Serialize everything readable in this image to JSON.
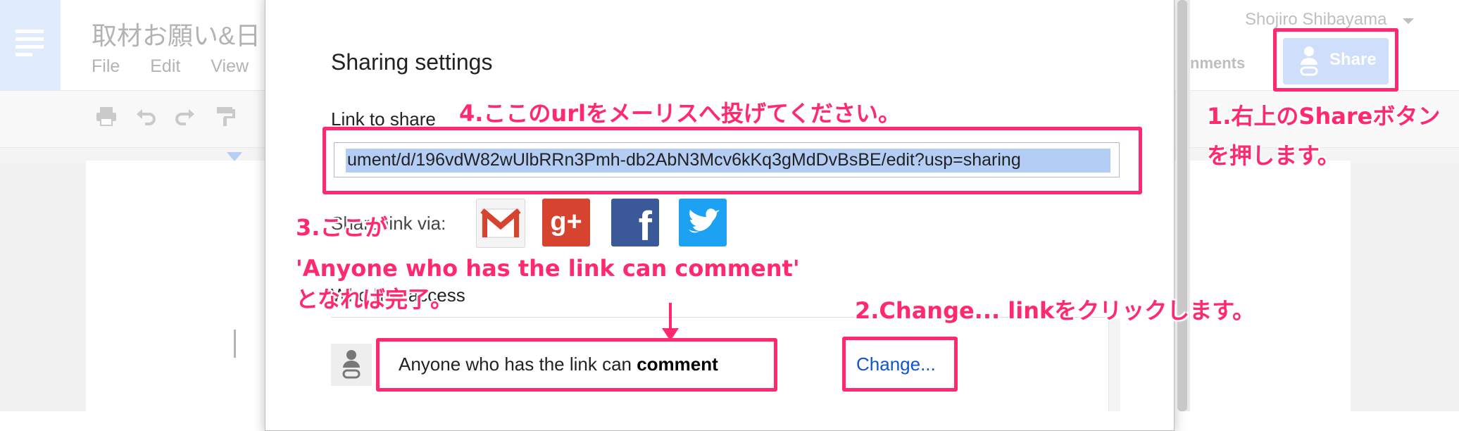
{
  "docs": {
    "title": "取材お願い&日",
    "menu": [
      "File",
      "Edit",
      "View"
    ],
    "user_name": "Shojiro Shibayama",
    "comments_label": "nments",
    "share_label": "Share"
  },
  "dialog": {
    "title": "Sharing settings",
    "link_label": "Link to share",
    "url": "ument/d/196vdW82wUlbRRn3Pmh-db2AbN3Mcv6kKq3gMdDvBsBE/edit?usp=sharing",
    "share_via_label": "Share link via:",
    "social": [
      {
        "name": "gmail",
        "glyph": "M",
        "color": "#d6432f"
      },
      {
        "name": "google-plus",
        "glyph": "g+",
        "color": "#d6432f"
      },
      {
        "name": "facebook",
        "glyph": "f",
        "color": "#3b5998"
      },
      {
        "name": "twitter",
        "glyph": "🐦",
        "color": "#1da1f2"
      }
    ],
    "who_label": "Who has access",
    "access_prefix": "Anyone who has the link can ",
    "access_level": "comment",
    "change_label": "Change..."
  },
  "annotations": {
    "step1_line1": "1.右上のShareボタン",
    "step1_line2": "を押します。",
    "step2": "2.Change... linkをクリックします。",
    "step3_line1": "3.ここが",
    "step3_line2": "'Anyone who has the link can comment'",
    "step3_line3": "となれば完了。",
    "step4": "4.ここのurlをメーリスへ投げてください。",
    "accent_color": "#ff2a6d"
  }
}
